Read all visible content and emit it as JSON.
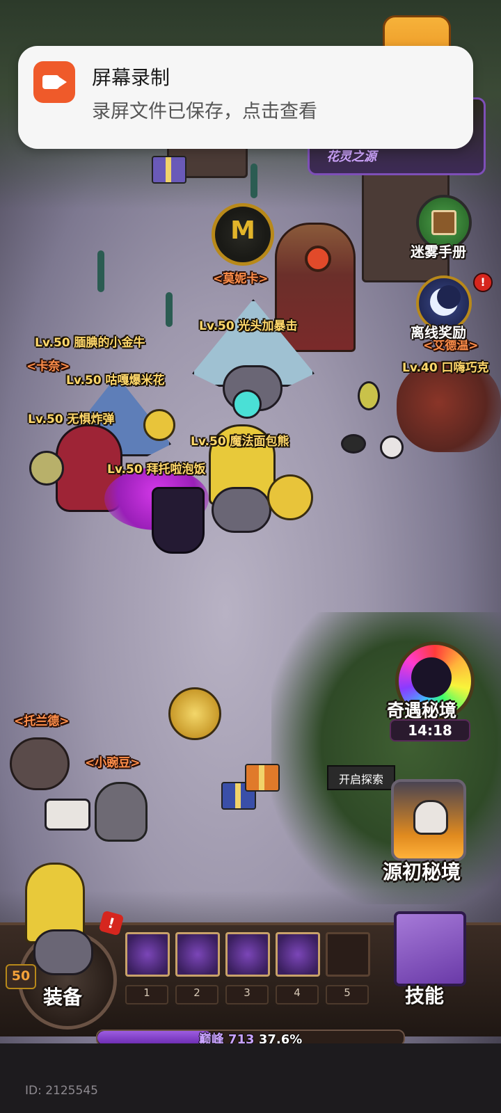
{
  "notification": {
    "title": "屏幕录制",
    "body": "录屏文件已保存，点击查看"
  },
  "event_banner": {
    "text": "花灵之源"
  },
  "side_buttons": {
    "mist_manual": "迷雾手册",
    "offline_reward": "离线奖励",
    "offline_badge": "!",
    "secret_realm": "奇遇秘境",
    "secret_timer": "14:18",
    "explore_tag": "开启探索",
    "origin_realm": "源初秘境"
  },
  "npcs": {
    "monica": "<莫妮卡>",
    "kana": "<卡奈>",
    "toland": "<托兰德>",
    "pea": "<小豌豆>",
    "partial_right": "<艾德温>"
  },
  "players": [
    "Lv.50 光头加暴击",
    "Lv.50 腼腆的小金牛",
    "Lv.50 咕嘎爆米花",
    "Lv.50 无惧炸弹",
    "Lv.50 魔法面包熊",
    "Lv.50 拜托啦泡饭",
    "Lv.40 口嗨巧克"
  ],
  "bottom_bar": {
    "equip_label": "装备",
    "level": "50",
    "alert": "!",
    "skill_label": "技能",
    "slots": [
      "1",
      "2",
      "3",
      "4",
      "5"
    ],
    "exp_label": "巅峰",
    "exp_value": "713",
    "exp_percent": "37.6%",
    "exp_fraction": 0.376
  },
  "player_id": "ID: 2125545",
  "colors": {
    "level_label": "#ffd86b",
    "npc_label": "#ff8e4a",
    "exp_fill": "#8a46d0",
    "notif_icon": "#ef5a2a"
  },
  "icons": {
    "monica_emblem": "crown-emblem-icon",
    "mist_manual": "book-icon",
    "offline_reward": "moon-icon",
    "secret_realm": "rainbow-orb-icon",
    "origin_realm": "skull-icon",
    "skill_book": "spellbook-icon",
    "notif_app": "video-camera-icon"
  }
}
